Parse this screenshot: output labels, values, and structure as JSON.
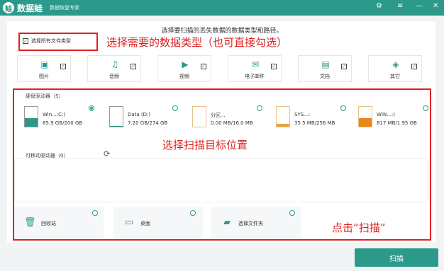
{
  "titlebar": {
    "logo_char": "蛙",
    "app_name": "数据蛙",
    "subtitle": "数据恢复专家",
    "icons": [
      "settings-icon",
      "menu-icon",
      "minimize-icon",
      "close-icon"
    ]
  },
  "instruction": "选择要扫描的丢失数据的数据类型和路径。",
  "select_all": {
    "label": "选择所有文件类型",
    "checked": true
  },
  "annotations": {
    "choose_type": "选择需要的数据类型（也可直接勾选）",
    "choose_location": "选择扫描目标位置",
    "click_scan": "点击“扫描”"
  },
  "file_types": [
    {
      "label": "图片",
      "icon": "image-icon",
      "checked": true
    },
    {
      "label": "音频",
      "icon": "music-icon",
      "checked": true
    },
    {
      "label": "视频",
      "icon": "video-icon",
      "checked": true
    },
    {
      "label": "电子邮件",
      "icon": "mail-icon",
      "checked": true
    },
    {
      "label": "文档",
      "icon": "document-icon",
      "checked": true
    },
    {
      "label": "其它",
      "icon": "other-icon",
      "checked": true
    }
  ],
  "hard_drives": {
    "label": "硬盘驱动器（5）",
    "items": [
      {
        "name": "Win...:C:)",
        "size": "85.9 GB/200 GB",
        "selected": true,
        "fill_fraction": 0.43,
        "fill_color": "#2b9a8a"
      },
      {
        "name": "Data (D:)",
        "size": "7.20 GB/274 GB",
        "selected": false,
        "fill_fraction": 0.03,
        "fill_color": "#2b9a8a"
      },
      {
        "name": "分区...",
        "size": "0.00 MB/16.0 MB",
        "selected": false,
        "fill_fraction": 0.0,
        "fill_color": "#e8a040"
      },
      {
        "name": "SYS...:",
        "size": "35.5 MB/256 MB",
        "selected": false,
        "fill_fraction": 0.14,
        "fill_color": "#e8a040"
      },
      {
        "name": "WIN...:)",
        "size": "817 MB/1.95 GB",
        "selected": false,
        "fill_fraction": 0.42,
        "fill_color": "#e8881a"
      }
    ]
  },
  "removable": {
    "label": "可移动驱动器（0）"
  },
  "locations": [
    {
      "label": "回收站",
      "icon": "trash-icon"
    },
    {
      "label": "桌面",
      "icon": "desktop-icon"
    },
    {
      "label": "选择文件夹",
      "icon": "folder-icon"
    }
  ],
  "scan_button": "扫描"
}
